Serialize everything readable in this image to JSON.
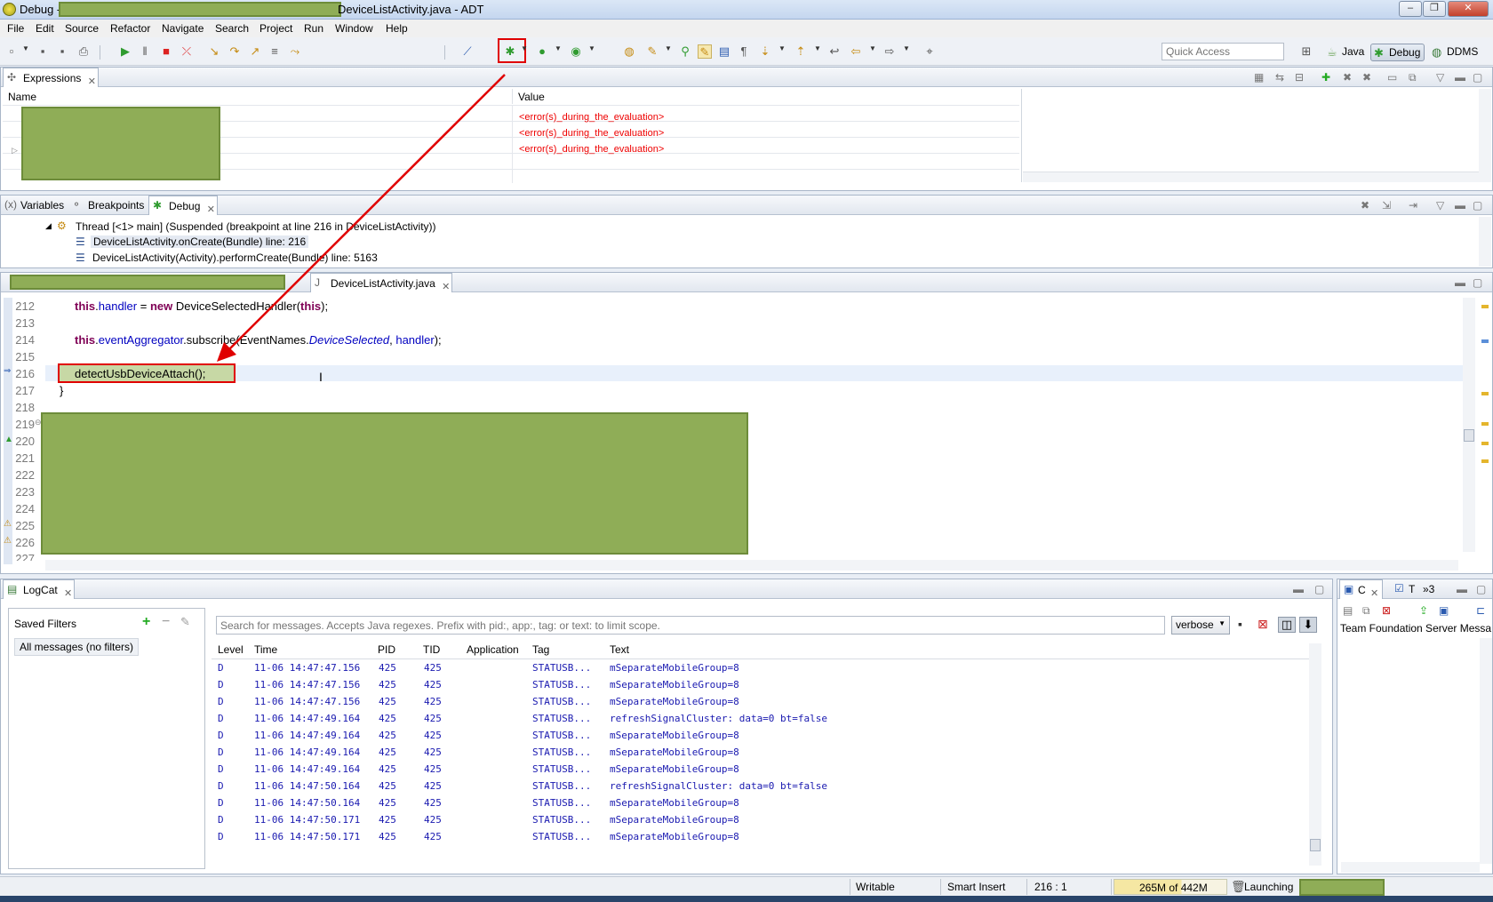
{
  "window": {
    "title_prefix": "Debug - ",
    "title_suffix": "DeviceListActivity.java - ADT"
  },
  "menu": [
    "File",
    "Edit",
    "Source",
    "Refactor",
    "Navigate",
    "Search",
    "Project",
    "Run",
    "Window",
    "Help"
  ],
  "toolbar": {
    "quick_access_placeholder": "Quick Access",
    "perspectives": [
      "Java",
      "Debug",
      "DDMS"
    ]
  },
  "expressions": {
    "tab": "Expressions",
    "columns": [
      "Name",
      "Value"
    ],
    "values": [
      "<error(s)_during_the_evaluation>",
      "<error(s)_during_the_evaluation>",
      "<error(s)_during_the_evaluation>"
    ]
  },
  "debug_view": {
    "tabs": [
      "Variables",
      "Breakpoints",
      "Debug"
    ],
    "thread": "Thread [<1> main] (Suspended (breakpoint at line 216 in DeviceListActivity))",
    "frames": [
      "DeviceListActivity.onCreate(Bundle) line: 216",
      "DeviceListActivity(Activity).performCreate(Bundle) line: 5163"
    ]
  },
  "editor": {
    "tab": "DeviceListActivity.java",
    "line_numbers": [
      "212",
      "213",
      "214",
      "215",
      "216",
      "217",
      "218",
      "219",
      "220",
      "221",
      "222",
      "223",
      "224",
      "225",
      "226",
      "227"
    ],
    "code": {
      "l212_kw": "this",
      "l212_field": "handler",
      "l212_eq": " = ",
      "l212_new": "new",
      "l212_rest": " DeviceSelectedHandler(",
      "l212_this": "this",
      "l212_end": ");",
      "l214_kw": "this",
      "l214_field": "eventAggregator",
      "l214_mid": ".subscribe(EventNames.",
      "l214_static": "DeviceSelected",
      "l214_sep": ", ",
      "l214_handler": "handler",
      "l214_end": ");",
      "l216": "detectUsbDeviceAttach();",
      "l217": "}"
    }
  },
  "logcat": {
    "tab": "LogCat",
    "saved_filters_label": "Saved Filters",
    "filter_item": "All messages (no filters)",
    "search_placeholder": "Search for messages. Accepts Java regexes. Prefix with pid:, app:, tag: or text: to limit scope.",
    "level_select": "verbose",
    "columns": [
      "Level",
      "Time",
      "PID",
      "TID",
      "Application",
      "Tag",
      "Text"
    ],
    "rows": [
      [
        "D",
        "11-06 14:47:47.156",
        "425",
        "425",
        "",
        "STATUSB...",
        "mSeparateMobileGroup=8"
      ],
      [
        "D",
        "11-06 14:47:47.156",
        "425",
        "425",
        "",
        "STATUSB...",
        "mSeparateMobileGroup=8"
      ],
      [
        "D",
        "11-06 14:47:47.156",
        "425",
        "425",
        "",
        "STATUSB...",
        "mSeparateMobileGroup=8"
      ],
      [
        "D",
        "11-06 14:47:49.164",
        "425",
        "425",
        "",
        "STATUSB...",
        "refreshSignalCluster: data=0 bt=false"
      ],
      [
        "D",
        "11-06 14:47:49.164",
        "425",
        "425",
        "",
        "STATUSB...",
        "mSeparateMobileGroup=8"
      ],
      [
        "D",
        "11-06 14:47:49.164",
        "425",
        "425",
        "",
        "STATUSB...",
        "mSeparateMobileGroup=8"
      ],
      [
        "D",
        "11-06 14:47:49.164",
        "425",
        "425",
        "",
        "STATUSB...",
        "mSeparateMobileGroup=8"
      ],
      [
        "D",
        "11-06 14:47:50.164",
        "425",
        "425",
        "",
        "STATUSB...",
        "refreshSignalCluster: data=0 bt=false"
      ],
      [
        "D",
        "11-06 14:47:50.164",
        "425",
        "425",
        "",
        "STATUSB...",
        "mSeparateMobileGroup=8"
      ],
      [
        "D",
        "11-06 14:47:50.171",
        "425",
        "425",
        "",
        "STATUSB...",
        "mSeparateMobileGroup=8"
      ],
      [
        "D",
        "11-06 14:47:50.171",
        "425",
        "425",
        "",
        "STATUSB...",
        "mSeparateMobileGroup=8"
      ]
    ]
  },
  "side_panel": {
    "tabs": [
      "C",
      "T",
      "»3"
    ],
    "label": "Team Foundation Server Messag"
  },
  "status": {
    "writable": "Writable",
    "insert_mode": "Smart Insert",
    "position": "216 : 1",
    "memory": "265M of 442M",
    "progress": "Launching"
  }
}
